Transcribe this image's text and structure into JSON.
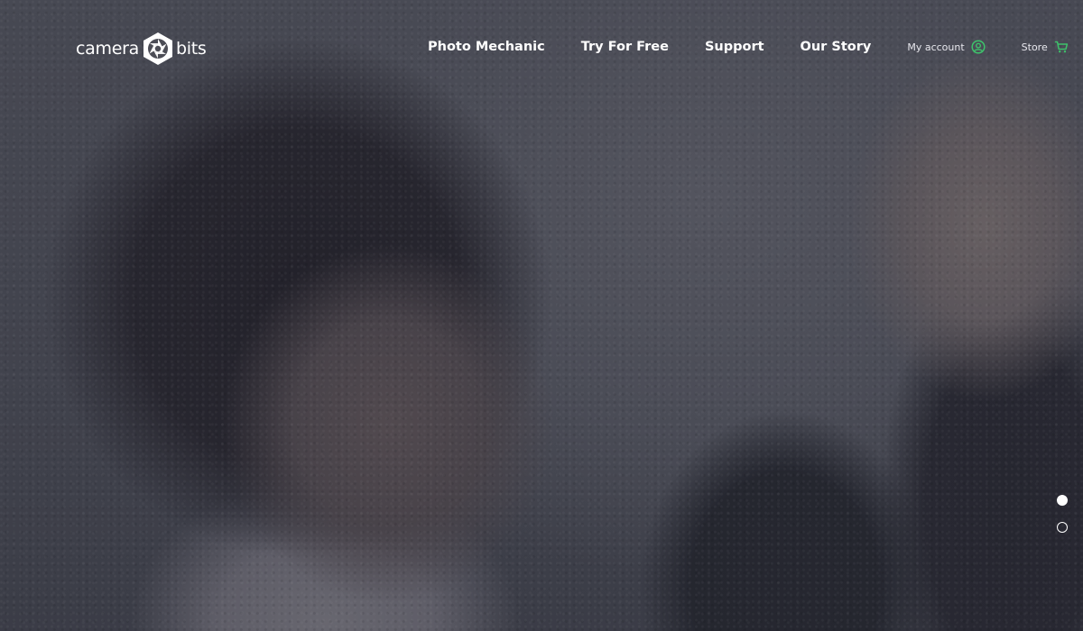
{
  "brand": {
    "word_left": "camera",
    "word_right": "bits",
    "mark_icon": "camera-shutter-hexagon-icon"
  },
  "nav": {
    "links": [
      {
        "label": "Photo Mechanic"
      },
      {
        "label": "Try For Free"
      },
      {
        "label": "Support"
      },
      {
        "label": "Our Story"
      }
    ],
    "account": {
      "label": "My account",
      "icon": "user-circle-icon"
    },
    "store": {
      "label": "Store",
      "icon": "shopping-cart-icon"
    }
  },
  "hero": {
    "background": "photo-two-women-laughing-looking-at-camera",
    "slides": [
      {
        "active": true
      },
      {
        "active": false
      }
    ]
  },
  "colors": {
    "accent": "#3ec26b",
    "text": "#ffffff",
    "overlay": "#1c1e2c"
  }
}
